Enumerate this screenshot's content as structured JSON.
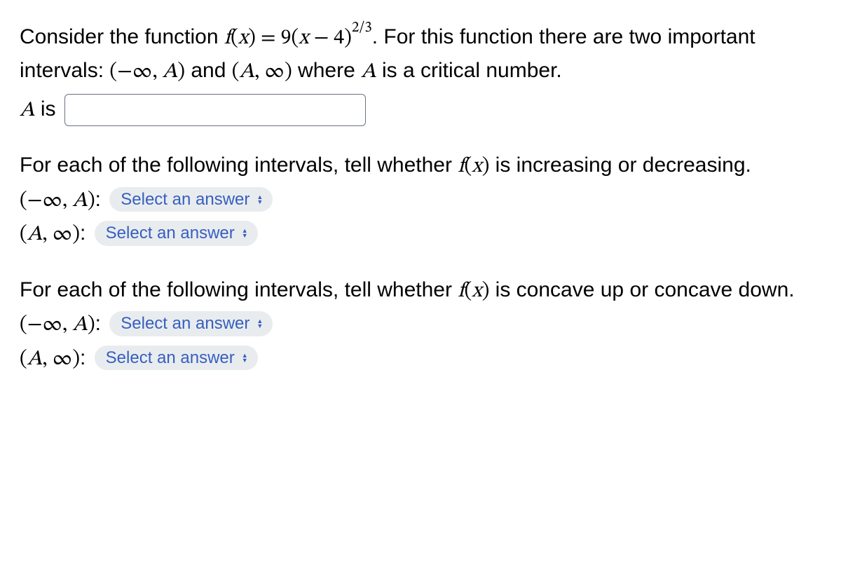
{
  "para1": {
    "t1": "Consider the function ",
    "fx": "f",
    "lpar": "(",
    "x": "x",
    "rpar": ")",
    "eq": " = ",
    "nine": "9",
    "lpar2": "(",
    "x2": "x",
    "minus": " − ",
    "four": "4",
    "rpar2": ")",
    "exp": "2/3",
    "t2": ". For this function there are two important intervals: ",
    "int1_l": "(",
    "int1_neginf": "−∞",
    "int1_comma": ", ",
    "int1_A": "A",
    "int1_r": ")",
    "t3": " and ",
    "int2_l": "(",
    "int2_A": "A",
    "int2_comma": ", ",
    "int2_inf": "∞",
    "int2_r": ")",
    "t4": " where ",
    "A": "A",
    "t5": " is a critical number."
  },
  "A_label_A": "A",
  "A_label_is": " is ",
  "para2": {
    "t1": "For each of the following intervals, tell whether ",
    "f": "f",
    "lpar": "(",
    "x": "x",
    "rpar": ")",
    "t2": " is increasing or decreasing."
  },
  "monotone": {
    "row1_l": "(",
    "row1_neginf": "−∞",
    "row1_comma": ", ",
    "row1_A": "A",
    "row1_r": ")",
    "row1_colon": ": ",
    "row2_l": "(",
    "row2_A": "A",
    "row2_comma": ", ",
    "row2_inf": "∞",
    "row2_r": ")",
    "row2_colon": ": "
  },
  "para3": {
    "t1": "For each of the following intervals, tell whether ",
    "f": "f",
    "lpar": "(",
    "x": "x",
    "rpar": ")",
    "t2": " is concave up or concave down."
  },
  "concave": {
    "row1_l": "(",
    "row1_neginf": "−∞",
    "row1_comma": ", ",
    "row1_A": "A",
    "row1_r": ")",
    "row1_colon": ": ",
    "row2_l": "(",
    "row2_A": "A",
    "row2_comma": ", ",
    "row2_inf": "∞",
    "row2_r": ")",
    "row2_colon": ": "
  },
  "select_label": "Select an answer"
}
